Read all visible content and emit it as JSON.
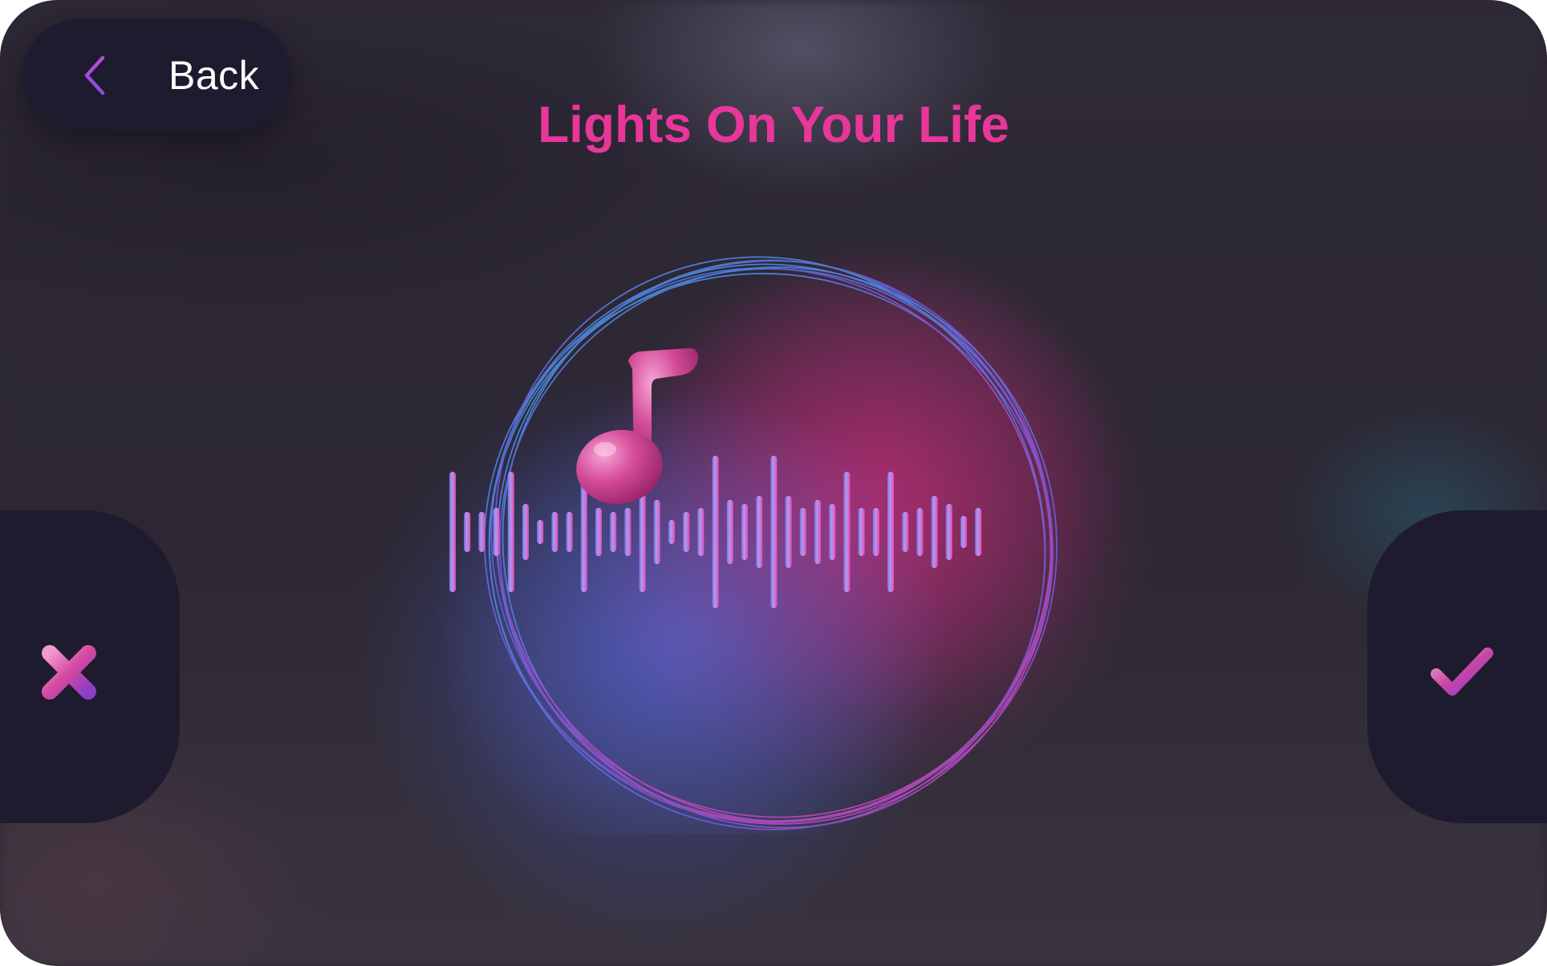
{
  "header": {
    "back_label": "Back",
    "back_icon": "chevron-left-icon"
  },
  "main": {
    "title": "Lights On Your Life",
    "center_icon": "music-note-icon",
    "waveform_icon": "sound-wave-icon",
    "rings_icon": "glow-rings-icon"
  },
  "actions": {
    "decline_icon": "close-x-icon",
    "accept_icon": "checkmark-icon"
  },
  "colors": {
    "accent_pink": "#e8369a",
    "panel_dark": "#1f1b2e",
    "wave_blue": "#7b7df5",
    "wave_pink": "#f04fb8",
    "ring_cyan": "#3aa0e0"
  }
}
